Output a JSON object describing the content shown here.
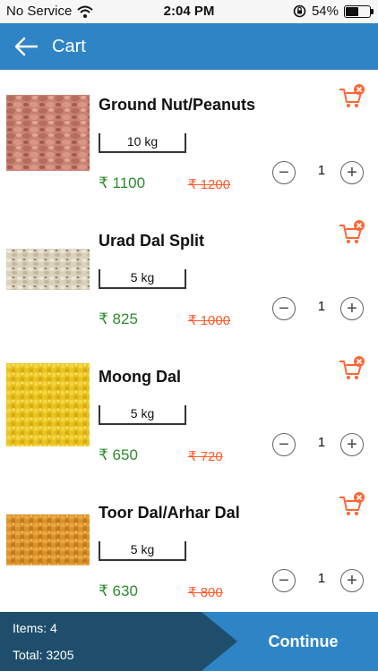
{
  "status_bar": {
    "carrier": "No Service",
    "time": "2:04 PM",
    "battery": "54%",
    "battery_level": 0.54
  },
  "header": {
    "title": "Cart",
    "back_icon": "arrow-left-icon"
  },
  "items": [
    {
      "name": "Ground Nut/Peanuts",
      "weight": "10 kg",
      "price": "₹ 1100",
      "mrp": "₹ 1200",
      "quantity": "1"
    },
    {
      "name": "Urad Dal Split",
      "weight": "5 kg",
      "price": "₹ 825",
      "mrp": "₹ 1000",
      "quantity": "1"
    },
    {
      "name": "Moong Dal",
      "weight": "5 kg",
      "price": "₹ 650",
      "mrp": "₹ 720",
      "quantity": "1"
    },
    {
      "name": "Toor Dal/Arhar Dal",
      "weight": "5 kg",
      "price": "₹ 630",
      "mrp": "₹ 800",
      "quantity": "1"
    }
  ],
  "footer": {
    "items_count": "Items: 4",
    "total": "Total: 3205",
    "continue_label": "Continue"
  },
  "colors": {
    "header": "#2f84c5",
    "footer_dark": "#1f4e6d",
    "price_green": "#2e8b2e",
    "mrp_orange": "#ff5a2a",
    "remove_icon": "#ff6633"
  }
}
